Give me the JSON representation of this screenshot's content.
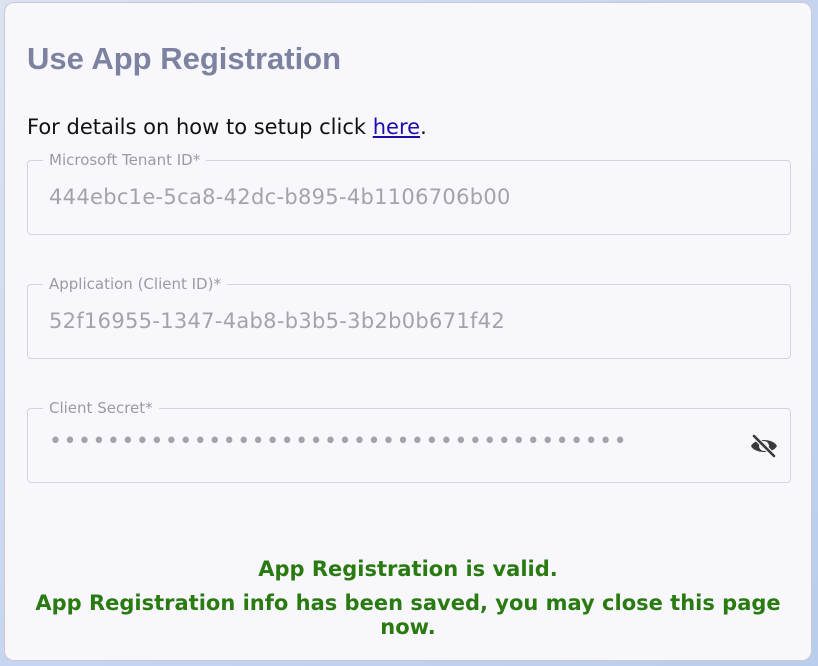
{
  "title": "Use App Registration",
  "intro": {
    "text": "For details on how to setup click ",
    "link": "here",
    "suffix": "."
  },
  "fields": {
    "tenant": {
      "label": "Microsoft Tenant ID*",
      "value": "444ebc1e-5ca8-42dc-b895-4b1106706b00"
    },
    "client": {
      "label": "Application (Client ID)*",
      "value": "52f16955-1347-4ab8-b3b5-3b2b0b671f42"
    },
    "secret": {
      "label": "Client Secret*",
      "masked_value": "••••••••••••••••••••••••••••••••••••••••",
      "toggle_icon": "eye-off-icon"
    }
  },
  "status": {
    "line1": "App Registration is valid.",
    "line2": "App Registration info has been saved, you may close this page now.",
    "color": "#2a7a12"
  },
  "colors": {
    "title": "#7c82a0",
    "link": "#1a0dab",
    "panel_background": "#f8f7fc"
  }
}
